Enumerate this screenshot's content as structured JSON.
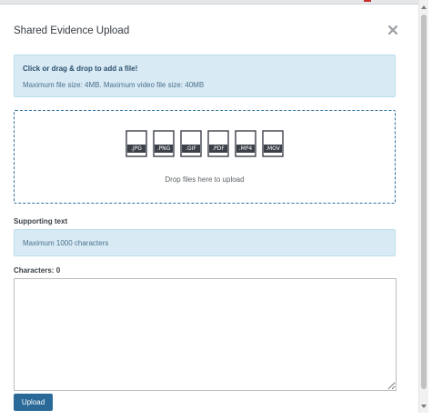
{
  "modal": {
    "title": "Shared Evidence Upload",
    "close_icon": "close-icon"
  },
  "info": {
    "headline": "Click or drag & drop to add a file!",
    "limits": "Maximum file size: 4MB. Maximum video file size: 40MB"
  },
  "dropzone": {
    "file_types": [
      ".JPG",
      ".PNG",
      ".GIF",
      ".PDF",
      ".MP4",
      ".MOV"
    ],
    "prompt": "Drop files here to upload"
  },
  "supporting": {
    "label": "Supporting text",
    "hint": "Maximum 1000 characters"
  },
  "characters": {
    "label": "Characters: 0",
    "value": ""
  },
  "actions": {
    "upload_label": "Upload"
  },
  "colors": {
    "accent": "#2b6a98",
    "info_bg": "#d8ebf5",
    "dropzone_border": "#2f6f9c"
  }
}
